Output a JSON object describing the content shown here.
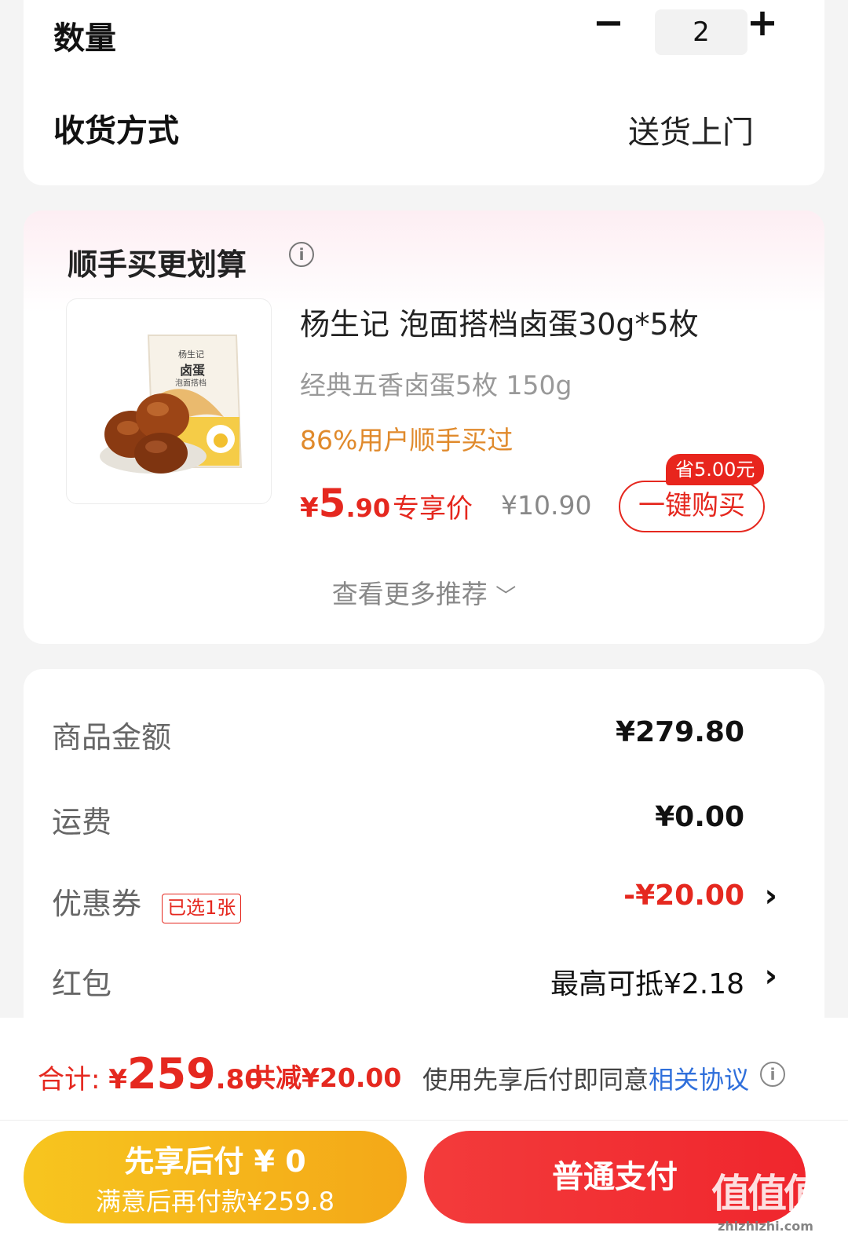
{
  "order": {
    "quantity_label": "数量",
    "minus_symbol": "−",
    "plus_symbol": "+",
    "quantity_value": "2",
    "shipping_label": "收货方式",
    "shipping_value": "送货上门"
  },
  "recommend": {
    "title": "顺手买更划算",
    "info_icon_glyph": "i",
    "product": {
      "image_icon": "braised-egg-product-image",
      "bag_brand": "杨生记",
      "bag_title": "卤蛋",
      "bag_subtitle": "泡面搭档",
      "name": "杨生记 泡面搭档卤蛋30g*5枚",
      "spec": "经典五香卤蛋5枚 150g",
      "social_proof": "86%用户顺手买过",
      "price_currency": "¥",
      "price_int": "5",
      "price_dec": ".90",
      "price_tag": "专享价",
      "original_price": "¥10.90",
      "save_badge": "省5.00元",
      "buy_button": "一键购买"
    },
    "more_label": "查看更多推荐",
    "more_chevron": "﹀"
  },
  "summary": {
    "goods_label": "商品金额",
    "goods_value": "¥279.80",
    "freight_label": "运费",
    "freight_value": "¥0.00",
    "coupon_label": "优惠券",
    "coupon_badge": "已选1张",
    "coupon_value": "-¥20.00",
    "redpacket_label": "红包",
    "redpacket_value": "最高可抵¥2.18",
    "chevron": "›"
  },
  "footer": {
    "total_label": "合计: ",
    "total_currency": "¥",
    "total_int": "259",
    "total_dec": ".80",
    "total_discount": "共减¥20.00",
    "agreement_text": "使用先享后付即同意",
    "agreement_link": "相关协议",
    "info_icon_glyph": "i",
    "pay_later_title": "先享后付 ¥ 0",
    "pay_later_sub": "满意后再付款¥259.8",
    "pay_now": "普通支付"
  },
  "watermark": {
    "main": "值值值",
    "sub": "zhizhizhi.com"
  },
  "colors": {
    "accent_red": "#e5281f",
    "accent_orange": "#e08a2c",
    "link_blue": "#2f6fdb",
    "pay_later_yellow": "#f6b81c",
    "pay_now_red": "#f0262d"
  }
}
